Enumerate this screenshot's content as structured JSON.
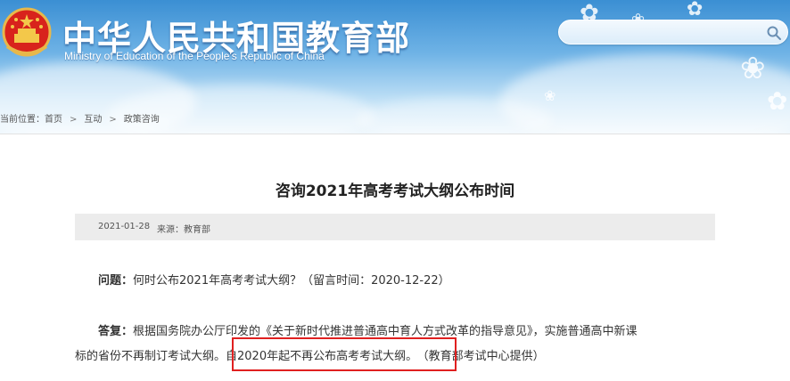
{
  "header": {
    "site_title": "中华人民共和国教育部",
    "site_subtitle": "Ministry of Education of the People's Republic of China",
    "search": {
      "value": "",
      "placeholder": ""
    }
  },
  "breadcrumb": {
    "prefix": "当前位置：",
    "items": [
      "首页",
      "互动",
      "政策咨询"
    ],
    "separator": ">"
  },
  "article": {
    "title": "咨询2021年高考考试大纲公布时间",
    "date": "2021-01-28",
    "source": "来源：教育部",
    "question_label": "问题：",
    "question_text": "何时公布2021年高考考试大纲？（留言时间：2020-12-22）",
    "answer_label": "答复：",
    "answer_line1": "根据国务院办公厅印发的《关于新时代推进普通高中育人方式改革的指导意见》，实施普通高中新课",
    "answer_line2_a": "标的省份不再制订考试大纲。",
    "answer_line2_highlight": "自2020年起不再公布高考考试大纲。",
    "answer_line2_b": "（教育部考试中心提供）"
  },
  "colors": {
    "header_sky": "#3b8fd3",
    "highlight_border": "#e02020",
    "meta_background": "#ececec"
  }
}
